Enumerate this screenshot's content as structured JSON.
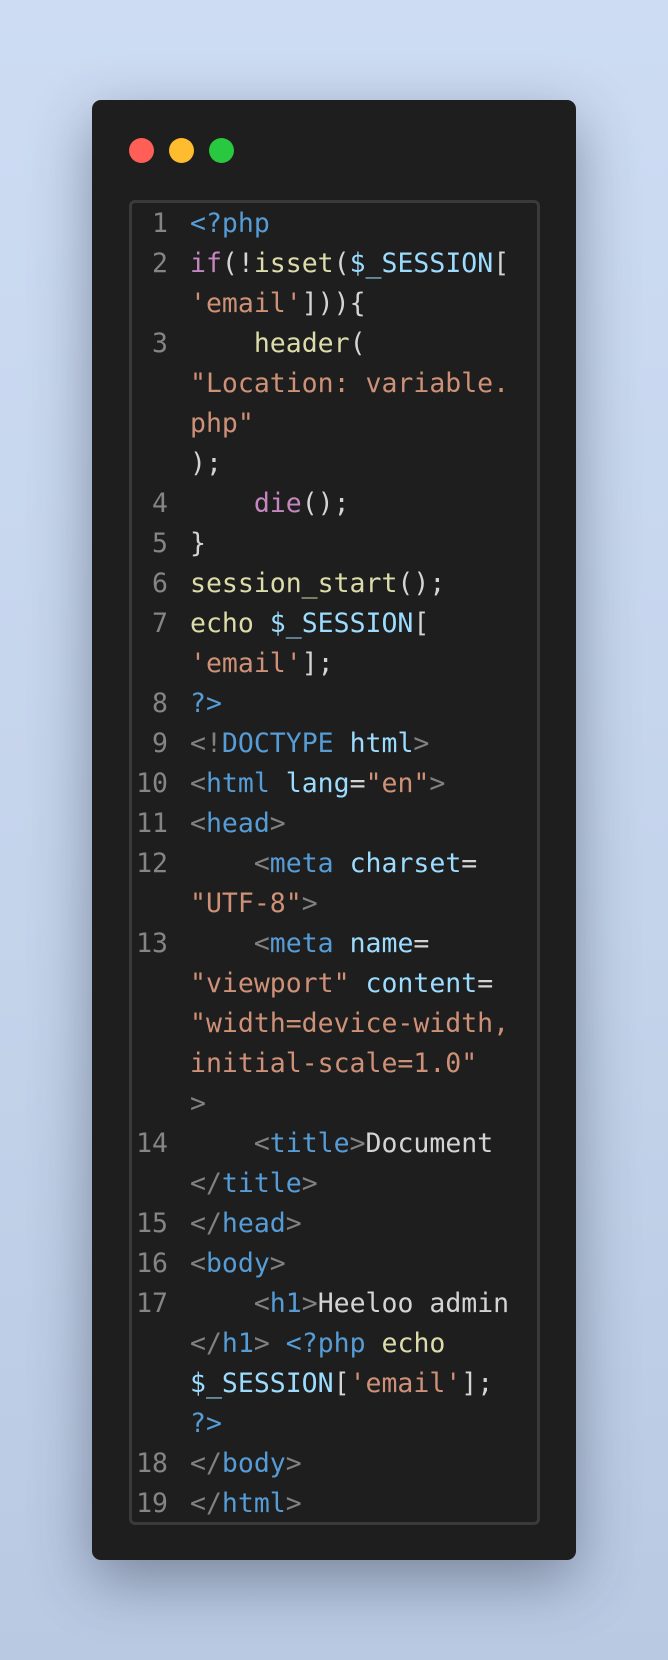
{
  "window": {
    "controls": [
      "close",
      "minimize",
      "maximize"
    ]
  },
  "colors": {
    "keyword": "#c586c0",
    "function": "#dcdcaa",
    "variable": "#9cdcfe",
    "string": "#ce9178",
    "tag": "#569cd6",
    "punctuation": "#d4d4d4",
    "bracket": "#808080"
  },
  "code": [
    {
      "n": "1",
      "rows": [
        [
          [
            "<?php",
            "t"
          ]
        ]
      ]
    },
    {
      "n": "2",
      "rows": [
        [
          [
            "if",
            "k"
          ],
          [
            "(!",
            "p"
          ],
          [
            "isset",
            "f"
          ],
          [
            "(",
            "p"
          ],
          [
            "$_SESSION",
            "v"
          ],
          [
            "[",
            "p"
          ]
        ],
        [
          [
            "'email'",
            "s"
          ],
          [
            "]))",
            "p"
          ],
          [
            "{",
            "p"
          ]
        ]
      ]
    },
    {
      "n": "3",
      "rows": [
        [
          [
            "    ",
            "p"
          ],
          [
            "header",
            "f"
          ],
          [
            "(",
            "p"
          ]
        ],
        [
          [
            "\"Location: variable.",
            "s"
          ]
        ],
        [
          [
            "php\"",
            "s"
          ]
        ],
        [
          [
            ");",
            "p"
          ]
        ]
      ]
    },
    {
      "n": "4",
      "rows": [
        [
          [
            "    ",
            "p"
          ],
          [
            "die",
            "k"
          ],
          [
            "();",
            "p"
          ]
        ]
      ]
    },
    {
      "n": "5",
      "rows": [
        [
          [
            "}",
            "p"
          ]
        ]
      ]
    },
    {
      "n": "6",
      "rows": [
        [
          [
            "session_start",
            "f"
          ],
          [
            "();",
            "p"
          ]
        ]
      ]
    },
    {
      "n": "7",
      "rows": [
        [
          [
            "echo",
            "f"
          ],
          [
            " ",
            "p"
          ],
          [
            "$_SESSION",
            "v"
          ],
          [
            "[",
            "p"
          ]
        ],
        [
          [
            "'email'",
            "s"
          ],
          [
            "];",
            "p"
          ]
        ]
      ]
    },
    {
      "n": "8",
      "rows": [
        [
          [
            "?>",
            "t"
          ]
        ]
      ]
    },
    {
      "n": "9",
      "rows": [
        [
          [
            "<!",
            "b"
          ],
          [
            "DOCTYPE",
            "t"
          ],
          [
            " ",
            "p"
          ],
          [
            "html",
            "v"
          ],
          [
            ">",
            "b"
          ]
        ]
      ]
    },
    {
      "n": "10",
      "rows": [
        [
          [
            "<",
            "b"
          ],
          [
            "html",
            "t"
          ],
          [
            " ",
            "p"
          ],
          [
            "lang",
            "v"
          ],
          [
            "=",
            "p"
          ],
          [
            "\"en\"",
            "s"
          ],
          [
            ">",
            "b"
          ]
        ]
      ]
    },
    {
      "n": "11",
      "rows": [
        [
          [
            "<",
            "b"
          ],
          [
            "head",
            "t"
          ],
          [
            ">",
            "b"
          ]
        ]
      ]
    },
    {
      "n": "12",
      "rows": [
        [
          [
            "    ",
            "p"
          ],
          [
            "<",
            "b"
          ],
          [
            "meta",
            "t"
          ],
          [
            " ",
            "p"
          ],
          [
            "charset",
            "v"
          ],
          [
            "=",
            "p"
          ]
        ],
        [
          [
            "\"UTF-8\"",
            "s"
          ],
          [
            ">",
            "b"
          ]
        ]
      ]
    },
    {
      "n": "13",
      "rows": [
        [
          [
            "    ",
            "p"
          ],
          [
            "<",
            "b"
          ],
          [
            "meta",
            "t"
          ],
          [
            " ",
            "p"
          ],
          [
            "name",
            "v"
          ],
          [
            "=",
            "p"
          ]
        ],
        [
          [
            "\"viewport\"",
            "s"
          ],
          [
            " ",
            "p"
          ],
          [
            "content",
            "v"
          ],
          [
            "=",
            "p"
          ]
        ],
        [
          [
            "\"width=device-width,",
            "s"
          ]
        ],
        [
          [
            "initial-scale=1.0\"",
            "s"
          ]
        ],
        [
          [
            ">",
            "b"
          ]
        ]
      ]
    },
    {
      "n": "14",
      "rows": [
        [
          [
            "    ",
            "p"
          ],
          [
            "<",
            "b"
          ],
          [
            "title",
            "t"
          ],
          [
            ">",
            "b"
          ],
          [
            "Document",
            "p"
          ]
        ],
        [
          [
            "</",
            "b"
          ],
          [
            "title",
            "t"
          ],
          [
            ">",
            "b"
          ]
        ]
      ]
    },
    {
      "n": "15",
      "rows": [
        [
          [
            "</",
            "b"
          ],
          [
            "head",
            "t"
          ],
          [
            ">",
            "b"
          ]
        ]
      ]
    },
    {
      "n": "16",
      "rows": [
        [
          [
            "<",
            "b"
          ],
          [
            "body",
            "t"
          ],
          [
            ">",
            "b"
          ]
        ]
      ]
    },
    {
      "n": "17",
      "rows": [
        [
          [
            "    ",
            "p"
          ],
          [
            "<",
            "b"
          ],
          [
            "h1",
            "t"
          ],
          [
            ">",
            "b"
          ],
          [
            "Heeloo admin",
            "p"
          ]
        ],
        [
          [
            "</",
            "b"
          ],
          [
            "h1",
            "t"
          ],
          [
            ">",
            "b"
          ],
          [
            " ",
            "p"
          ],
          [
            "<?php",
            "t"
          ],
          [
            " ",
            "p"
          ],
          [
            "echo",
            "f"
          ]
        ],
        [
          [
            "$_SESSION",
            "v"
          ],
          [
            "[",
            "p"
          ],
          [
            "'email'",
            "s"
          ],
          [
            "];",
            "p"
          ]
        ],
        [
          [
            "?>",
            "t"
          ]
        ]
      ]
    },
    {
      "n": "18",
      "rows": [
        [
          [
            "</",
            "b"
          ],
          [
            "body",
            "t"
          ],
          [
            ">",
            "b"
          ]
        ]
      ]
    },
    {
      "n": "19",
      "rows": [
        [
          [
            "</",
            "b"
          ],
          [
            "html",
            "t"
          ],
          [
            ">",
            "b"
          ]
        ]
      ]
    }
  ]
}
